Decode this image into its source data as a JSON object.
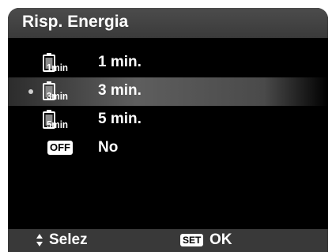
{
  "title": "Risp. Energia",
  "items": [
    {
      "icon_text": "1min",
      "label": "1 min."
    },
    {
      "icon_text": "3min",
      "label": "3 min."
    },
    {
      "icon_text": "5min",
      "label": "5 min."
    },
    {
      "icon_text": "OFF",
      "label": "No"
    }
  ],
  "footer": {
    "select_label": "Selez",
    "set_badge": "SET",
    "ok_label": "OK"
  },
  "icons": {
    "timer_battery": "battery-timer-icon",
    "off": "off-icon",
    "nav_arrows": "up-down-arrow-icon"
  },
  "colors": {
    "background": "#000000",
    "header": "#444444",
    "footer": "#393939",
    "text": "#ffffff",
    "bullet": "#cfcfcf"
  }
}
